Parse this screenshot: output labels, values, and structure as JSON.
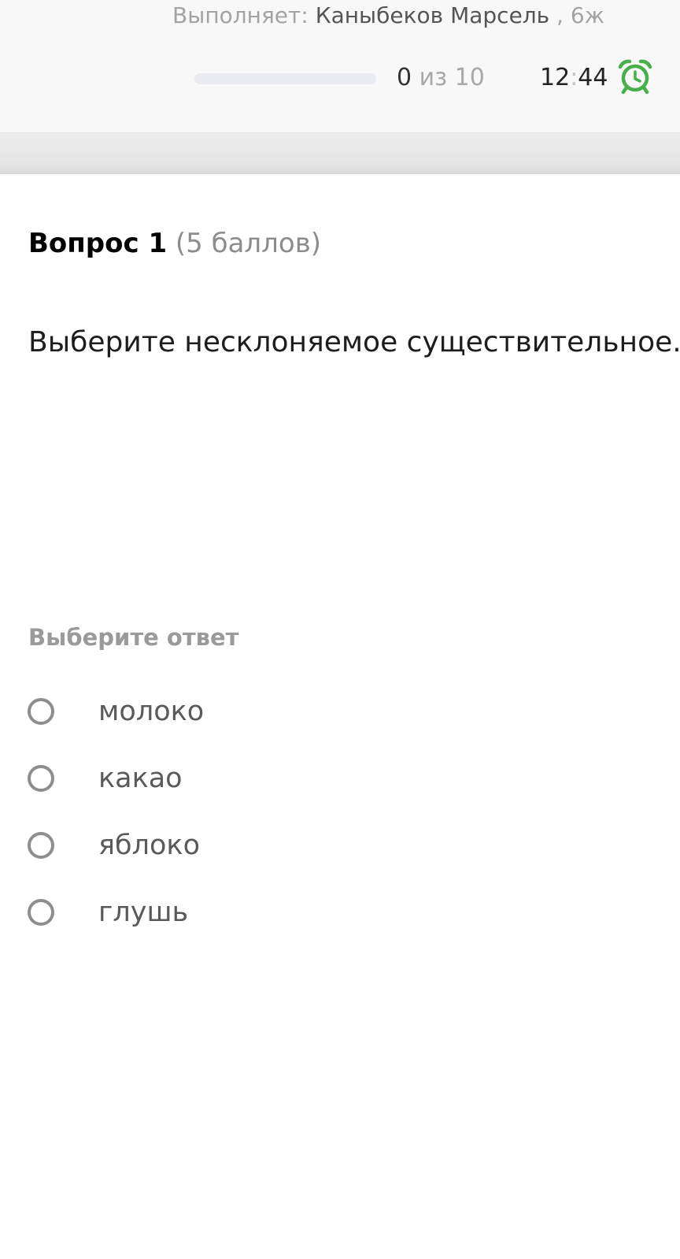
{
  "header": {
    "performer_label": "Выполняет:",
    "performer_name": "Каныбеков Марсель",
    "performer_class": ", 6ж",
    "progress": {
      "answered": "0",
      "of_word": "из",
      "total": "10",
      "fraction": 0
    },
    "timer": {
      "minutes": "12",
      "separator": ":",
      "seconds": "44"
    },
    "alarm_icon": "alarm-clock-icon",
    "accent_color": "#48b04a"
  },
  "question": {
    "number_label": "Вопрос 1",
    "points_label": "(5 баллов)",
    "text": "Выберите несклоняемое существительное.",
    "answer_hint": "Выберите ответ",
    "options": [
      {
        "label": "молоко",
        "selected": false
      },
      {
        "label": "какао",
        "selected": false
      },
      {
        "label": "яблоко",
        "selected": false
      },
      {
        "label": "глушь",
        "selected": false
      }
    ]
  }
}
